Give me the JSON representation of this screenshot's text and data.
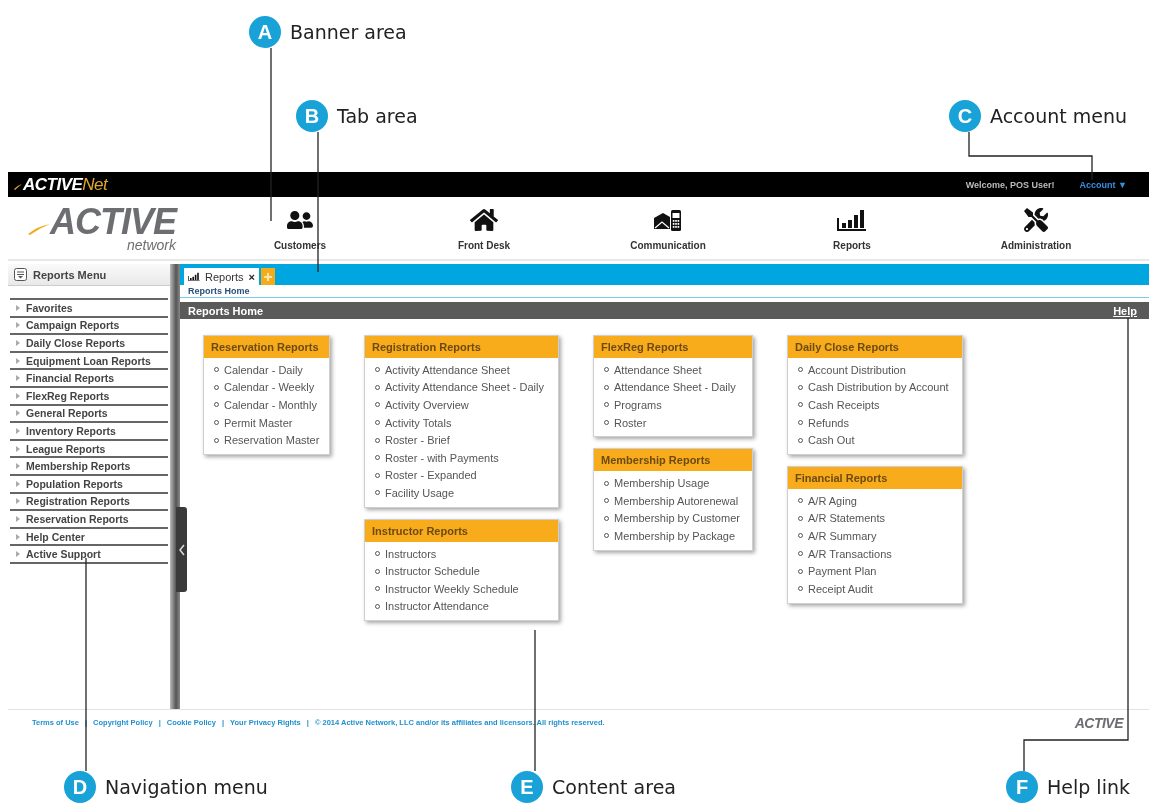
{
  "top_bar": {
    "logo": {
      "main": "ACTIVE",
      "accent": "Net"
    },
    "welcome": "Welcome, POS User!",
    "account_menu": "Account",
    "account_caret": "▼"
  },
  "banner": {
    "logo": {
      "main": "ACTIVE",
      "sub": "network"
    },
    "nav": [
      {
        "label": "Customers"
      },
      {
        "label": "Front Desk"
      },
      {
        "label": "Communication"
      },
      {
        "label": "Reports"
      },
      {
        "label": "Administration"
      }
    ]
  },
  "sidebar": {
    "title": "Reports Menu",
    "items": [
      "Favorites",
      "Campaign Reports",
      "Daily Close Reports",
      "Equipment Loan Reports",
      "Financial Reports",
      "FlexReg Reports",
      "General Reports",
      "Inventory Reports",
      "League Reports",
      "Membership Reports",
      "Population Reports",
      "Registration Reports",
      "Reservation Reports",
      "Help Center",
      "Active Support"
    ]
  },
  "tabs": [
    {
      "label": "Reports",
      "close": "×",
      "selected": true
    }
  ],
  "breadcrumb": "Reports Home",
  "section": {
    "title": "Reports Home",
    "help": "Help"
  },
  "report_columns": [
    [
      {
        "title": "Reservation Reports",
        "items": [
          "Calendar - Daily",
          "Calendar - Weekly",
          "Calendar - Monthly",
          "Permit Master",
          "Reservation Master"
        ]
      }
    ],
    [
      {
        "title": "Registration Reports",
        "items": [
          "Activity Attendance Sheet",
          "Activity Attendance Sheet - Daily",
          "Activity Overview",
          "Activity Totals",
          "Roster - Brief",
          "Roster - with Payments",
          "Roster - Expanded",
          "Facility Usage"
        ]
      },
      {
        "title": "Instructor Reports",
        "items": [
          "Instructors",
          "Instructor Schedule",
          "Instructor Weekly Schedule",
          "Instructor Attendance"
        ]
      }
    ],
    [
      {
        "title": "FlexReg Reports",
        "items": [
          "Attendance Sheet",
          "Attendance Sheet - Daily",
          "Programs",
          "Roster"
        ]
      },
      {
        "title": "Membership Reports",
        "items": [
          "Membership Usage",
          "Membership Autorenewal",
          "Membership by Customer",
          "Membership by Package"
        ]
      }
    ],
    [
      {
        "title": "Daily Close Reports",
        "items": [
          "Account Distribution",
          "Cash Distribution by Account",
          "Cash Receipts",
          "Refunds",
          "Cash Out"
        ]
      },
      {
        "title": "Financial Reports",
        "items": [
          "A/R Aging",
          "A/R Statements",
          "A/R Summary",
          "A/R Transactions",
          "Payment Plan",
          "Receipt Audit"
        ]
      }
    ]
  ],
  "footer": {
    "links": [
      "Terms of Use",
      "Copyright Policy",
      "Cookie Policy",
      "Your Privacy Rights"
    ],
    "separator": "|",
    "copyright": "© 2014 Active Network, LLC and/or its affiliates and licensors. All rights reserved.",
    "logo": "ACTIVE"
  },
  "callouts": [
    {
      "letter": "A",
      "label": "Banner area"
    },
    {
      "letter": "B",
      "label": "Tab area"
    },
    {
      "letter": "C",
      "label": "Account menu"
    },
    {
      "letter": "D",
      "label": "Navigation menu"
    },
    {
      "letter": "E",
      "label": "Content area"
    },
    {
      "letter": "F",
      "label": "Help link"
    }
  ]
}
